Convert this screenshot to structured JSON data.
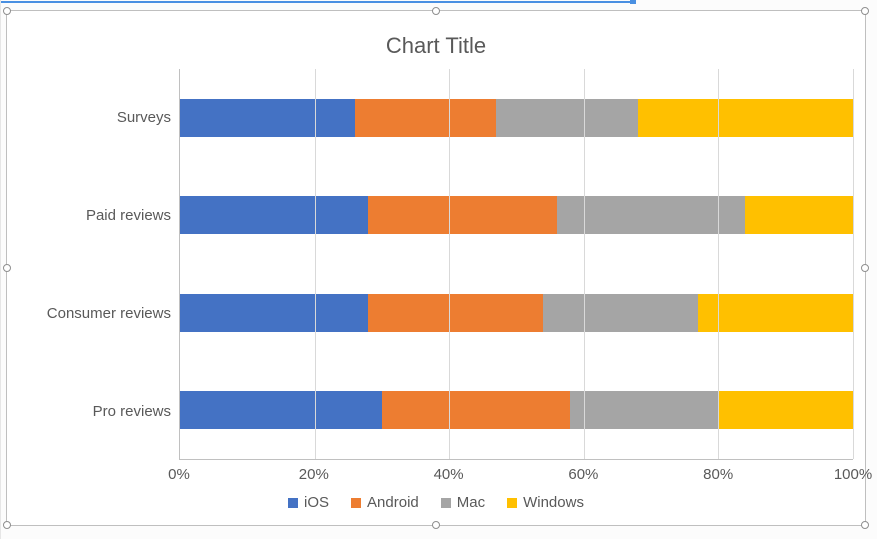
{
  "chart_data": {
    "type": "bar",
    "orientation": "horizontal",
    "stacking": "percent",
    "title": "Chart Title",
    "xlabel": "",
    "ylabel": "",
    "xlim": [
      0,
      100
    ],
    "x_ticks": [
      "0%",
      "20%",
      "40%",
      "60%",
      "80%",
      "100%"
    ],
    "categories_display_order": [
      "Surveys",
      "Paid reviews",
      "Consumer reviews",
      "Pro reviews"
    ],
    "categories": [
      "Pro reviews",
      "Consumer reviews",
      "Paid reviews",
      "Surveys"
    ],
    "series": [
      {
        "name": "iOS",
        "color": "#4472C4",
        "values": [
          30,
          28,
          28,
          26
        ]
      },
      {
        "name": "Android",
        "color": "#ED7D31",
        "values": [
          28,
          26,
          28,
          21
        ]
      },
      {
        "name": "Mac",
        "color": "#A5A5A5",
        "values": [
          22,
          23,
          28,
          21
        ]
      },
      {
        "name": "Windows",
        "color": "#FFC000",
        "values": [
          20,
          23,
          16,
          32
        ]
      }
    ],
    "grid": {
      "x": true,
      "y": false
    },
    "legend_position": "bottom"
  }
}
